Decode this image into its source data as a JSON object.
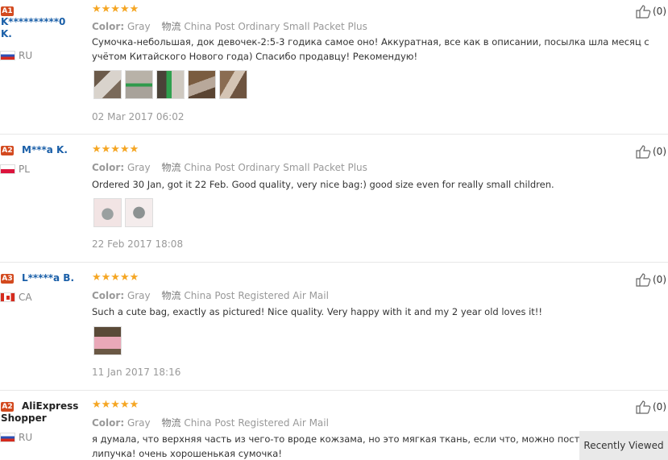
{
  "reviews": [
    {
      "level": "A1",
      "username_line1": "K**********0",
      "username_line2": "K.",
      "country": "RU",
      "color_label": "Color:",
      "color_value": "Gray",
      "shipping_label": "物流",
      "shipping_value": "China Post Ordinary Small Packet Plus",
      "text": "Сумочка-небольшая, док девочек-2:5-3 годика самое оно! Аккуратная, все как в описании, посылка шла месяц с учётом Китайского Нового года) Спасибо продавцу! Рекомендую!",
      "date": "02 Mar 2017 06:02",
      "likes": "(0)"
    },
    {
      "level": "A2",
      "username_line1": "M***a K.",
      "username_line2": "",
      "country": "PL",
      "color_label": "Color:",
      "color_value": "Gray",
      "shipping_label": "物流",
      "shipping_value": "China Post Ordinary Small Packet Plus",
      "text": "Ordered 30 Jan, got it 22 Feb. Good quality, very nice bag:) good size even for really small children.",
      "date": "22 Feb 2017 18:08",
      "likes": "(0)"
    },
    {
      "level": "A3",
      "username_line1": "L*****a B.",
      "username_line2": "",
      "country": "CA",
      "color_label": "Color:",
      "color_value": "Gray",
      "shipping_label": "物流",
      "shipping_value": "China Post Registered Air Mail",
      "text": "Such a cute bag, exactly as pictured! Nice quality. Very happy with it and my 2 year old loves it!!",
      "date": "11 Jan 2017 18:16",
      "likes": "(0)"
    },
    {
      "level": "A2",
      "username_line1": "AliExpress",
      "username_line2": "Shopper",
      "country": "RU",
      "color_label": "Color:",
      "color_value": "Gray",
      "shipping_label": "物流",
      "shipping_value": "China Post Registered Air Mail",
      "text": "я думала, что верхняя часть из чего-то вроде кожзама, но это мягкая ткань, если что, можно постирать. липучка! очень хорошенькая сумочка!",
      "date": "",
      "likes": "(0)"
    }
  ],
  "stars": "★★★★★",
  "recently_viewed": "Recently Viewed",
  "colors": {
    "star": "#f5a623",
    "username": "#1a5fa8",
    "level_badge": "#d34a1f"
  }
}
